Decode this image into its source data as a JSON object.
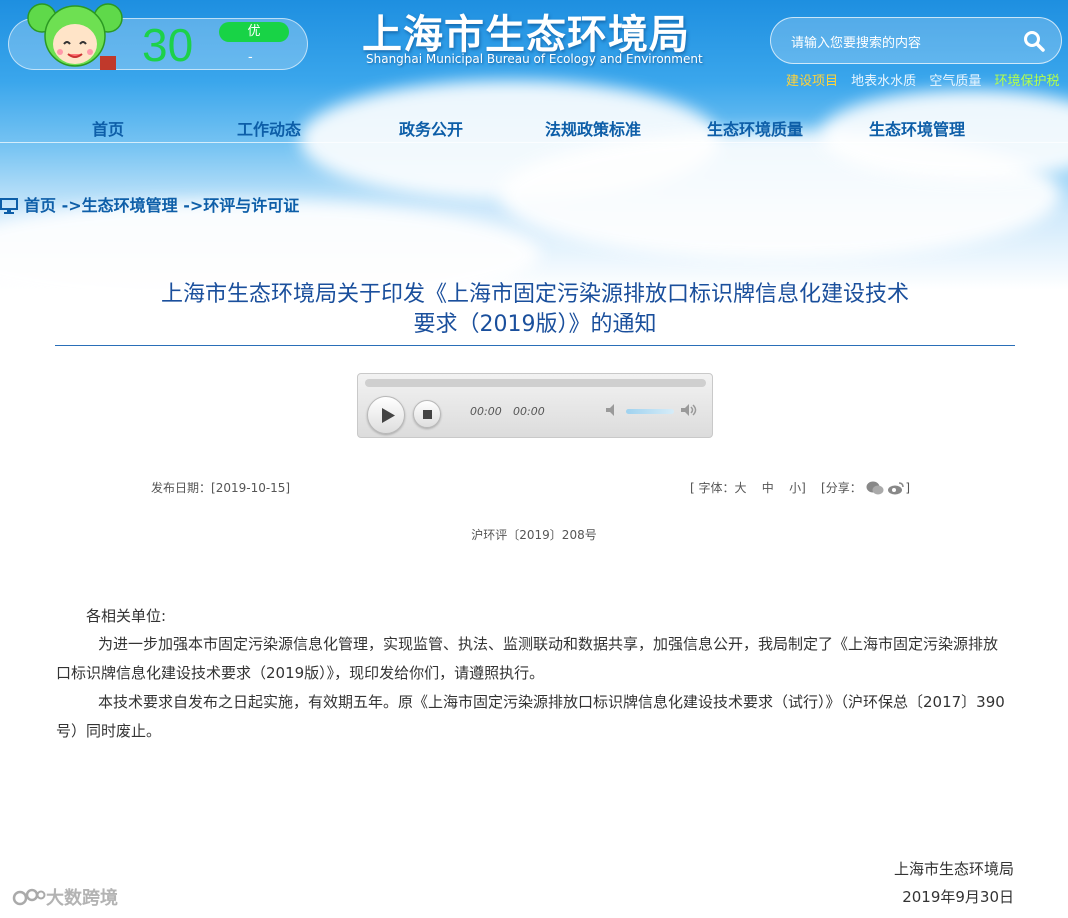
{
  "header": {
    "aqi": {
      "value": "30",
      "level": "优",
      "sub": "-"
    },
    "logo_cn": "上海市生态环境局",
    "logo_en": "Shanghai Municipal Bureau of Ecology and Environment",
    "search": {
      "placeholder": "请输入您要搜索的内容"
    },
    "quick_links": [
      "建设项目",
      "地表水水质",
      "空气质量",
      "环境保护税"
    ]
  },
  "nav": [
    "首页",
    "工作动态",
    "政务公开",
    "法规政策标准",
    "生态环境质量",
    "生态环境管理"
  ],
  "breadcrumb": {
    "home": "首页",
    "sep1": " ->",
    "level1": "生态环境管理",
    "sep2": " ->",
    "level2": "环评与许可证"
  },
  "article": {
    "title_line1": "上海市生态环境局关于印发《上海市固定污染源排放口标识牌信息化建设技术",
    "title_line2": "要求（2019版）》的通知",
    "publish_date_label": "发布日期：",
    "publish_date": "[2019-10-15]",
    "font_label": "[ 字体：",
    "font_large": "大",
    "font_medium": "中",
    "font_small": "小",
    "font_close": "]",
    "share_label": "[分享：",
    "share_close": "]",
    "doc_number": "沪环评〔2019〕208号",
    "salutation": "各相关单位:",
    "para1": "为进一步加强本市固定污染源信息化管理，实现监管、执法、监测联动和数据共享，加强信息公开，我局制定了《上海市固定污染源排放口标识牌信息化建设技术要求（2019版）》，现印发给你们，请遵照执行。",
    "para2": "本技术要求自发布之日起实施，有效期五年。原《上海市固定污染源排放口标识牌信息化建设技术要求（试行）》（沪环保总〔2017〕390号）同时废止。",
    "signature": "上海市生态环境局",
    "sign_date": "2019年9月30日"
  },
  "player": {
    "current_time": "00:00",
    "duration": "00:00",
    "progress": 0,
    "volume": 0.75
  },
  "watermark": "大数跨境",
  "colors": {
    "nav": "#0d5ea8",
    "title": "#1a4f9c",
    "aqi": "#1dd14a"
  }
}
